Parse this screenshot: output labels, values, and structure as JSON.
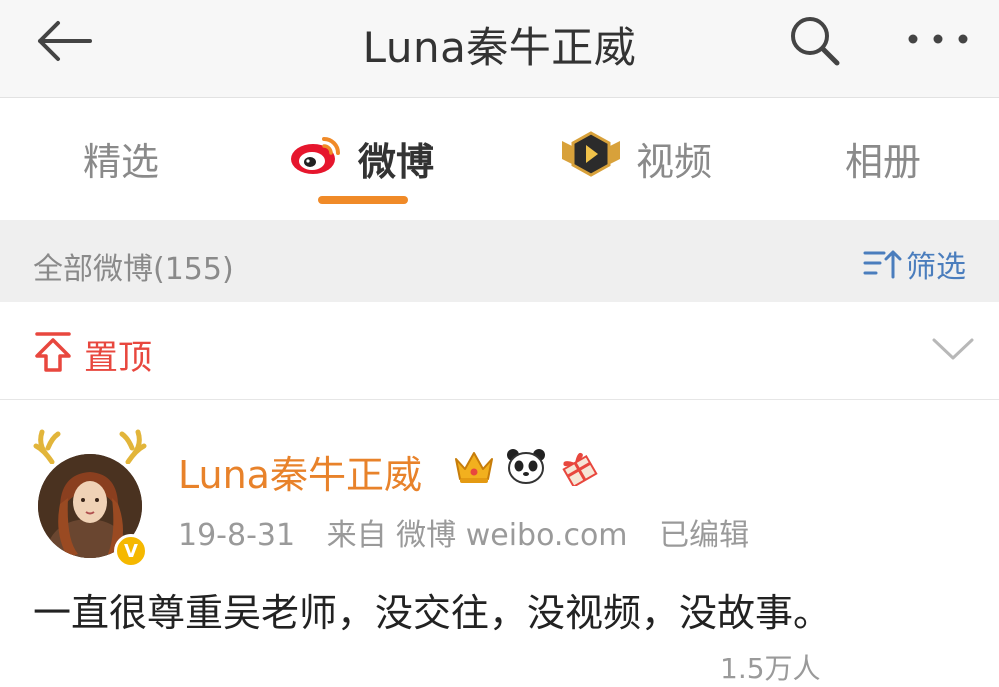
{
  "navbar": {
    "title": "Luna秦牛正威",
    "back_icon": "back-arrow-icon",
    "search_icon": "search-icon",
    "more_icon": "more-icon"
  },
  "tabs": [
    {
      "label": "精选",
      "active": false
    },
    {
      "label": "微博",
      "active": true,
      "icon": "weibo-logo-icon"
    },
    {
      "label": "视频",
      "active": false,
      "icon": "video-badge-icon"
    },
    {
      "label": "相册",
      "active": false
    }
  ],
  "accent_color": "#f08a28",
  "filterbar": {
    "count_label": "全部微博(155)",
    "filter_label": "筛选"
  },
  "pinned": {
    "label": "置顶"
  },
  "post": {
    "author": "Luna秦牛正威",
    "badges": [
      "crown-icon",
      "panda-icon",
      "gift-icon"
    ],
    "date": "19-8-31",
    "source": "来自 微博 weibo.com",
    "edited": "已编辑",
    "verified_mark": "V",
    "text": "一直很尊重吴老师，没交往，没视频，没故事。",
    "footer": "1.5万人"
  }
}
